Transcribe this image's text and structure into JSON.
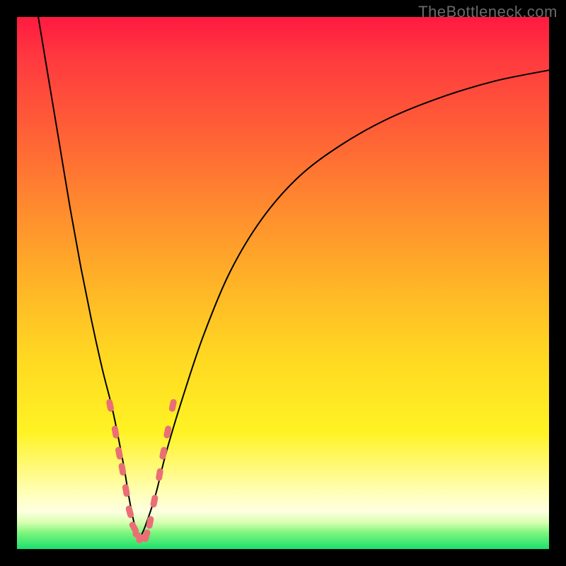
{
  "watermark": "TheBottleneck.com",
  "chart_data": {
    "type": "line",
    "title": "",
    "xlabel": "",
    "ylabel": "",
    "xlim": [
      0,
      100
    ],
    "ylim": [
      0,
      100
    ],
    "note": "Axes are unlabeled; values are estimated proportionally from the plot area (0–100).",
    "series": [
      {
        "name": "left-descending-curve",
        "x": [
          4,
          6,
          8,
          10,
          12,
          14,
          16,
          18,
          20,
          21,
          22,
          23
        ],
        "y": [
          100,
          88,
          76,
          64,
          53,
          43,
          34,
          26,
          16,
          10,
          5,
          2
        ]
      },
      {
        "name": "right-ascending-curve",
        "x": [
          23,
          24,
          26,
          28,
          31,
          35,
          40,
          46,
          53,
          61,
          70,
          80,
          90,
          100
        ],
        "y": [
          2,
          4,
          10,
          18,
          28,
          40,
          52,
          62,
          70,
          76,
          81,
          85,
          88,
          90
        ]
      }
    ],
    "markers": {
      "name": "highlighted-points",
      "comment": "Salmon-colored dash/dot cluster near trough of V",
      "points": [
        {
          "x": 17.5,
          "y": 27
        },
        {
          "x": 18.5,
          "y": 22
        },
        {
          "x": 19.2,
          "y": 18
        },
        {
          "x": 19.8,
          "y": 15
        },
        {
          "x": 20.5,
          "y": 11
        },
        {
          "x": 21.2,
          "y": 7
        },
        {
          "x": 22.0,
          "y": 4
        },
        {
          "x": 22.8,
          "y": 2.5
        },
        {
          "x": 23.5,
          "y": 2
        },
        {
          "x": 24.3,
          "y": 2.5
        },
        {
          "x": 25.0,
          "y": 5
        },
        {
          "x": 25.8,
          "y": 9
        },
        {
          "x": 26.8,
          "y": 14
        },
        {
          "x": 27.5,
          "y": 18
        },
        {
          "x": 28.3,
          "y": 22
        },
        {
          "x": 29.3,
          "y": 27
        }
      ]
    },
    "gradient_bands": [
      {
        "y": 100,
        "color": "#ff1a3f"
      },
      {
        "y": 50,
        "color": "#ffb327"
      },
      {
        "y": 20,
        "color": "#fff324"
      },
      {
        "y": 5,
        "color": "#d8ffb0"
      },
      {
        "y": 0,
        "color": "#1be06f"
      }
    ]
  }
}
